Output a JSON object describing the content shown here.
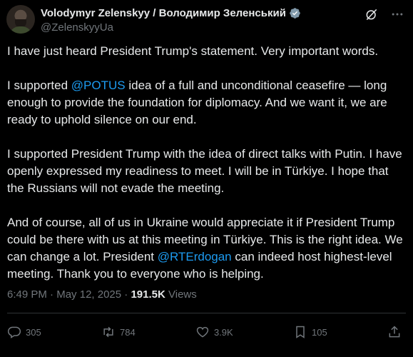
{
  "author": {
    "display_name": "Volodymyr Zelenskyy / Володимир Зеленський",
    "handle": "@ZelenskyyUa"
  },
  "tweet": {
    "p1": "I have just heard President Trump's statement. Very important words.",
    "p2_before": "I supported ",
    "p2_mention": "@POTUS",
    "p2_after": " idea of a full and unconditional ceasefire — long enough to provide the foundation for diplomacy. And we want it, we are ready to uphold silence on our end.",
    "p3": "I supported President Trump with the idea of direct talks with Putin. I have openly expressed my readiness to meet. I will be in Türkiye. I hope that the Russians will not evade the meeting.",
    "p4_before": "And of course, all of us in Ukraine would appreciate it if President Trump could be there with us at this meeting in Türkiye. This is the right idea. We can change a lot. President ",
    "p4_mention": "@RTErdogan",
    "p4_after": " can indeed host highest-level meeting. Thank you to everyone who is helping."
  },
  "meta": {
    "time": "6:49 PM",
    "separator": " · ",
    "date": "May 12, 2025",
    "views_count": "191.5K",
    "views_label": " Views"
  },
  "actions": {
    "replies": "305",
    "reposts": "784",
    "likes": "3.9K",
    "bookmarks": "105"
  },
  "icons": [
    "verified-badge-icon",
    "grok-icon",
    "more-icon",
    "reply-icon",
    "repost-icon",
    "like-icon",
    "bookmark-icon",
    "share-icon"
  ],
  "colors": {
    "background": "#000000",
    "text": "#e7e9ea",
    "secondary": "#71767b",
    "link": "#1d9bf0"
  }
}
